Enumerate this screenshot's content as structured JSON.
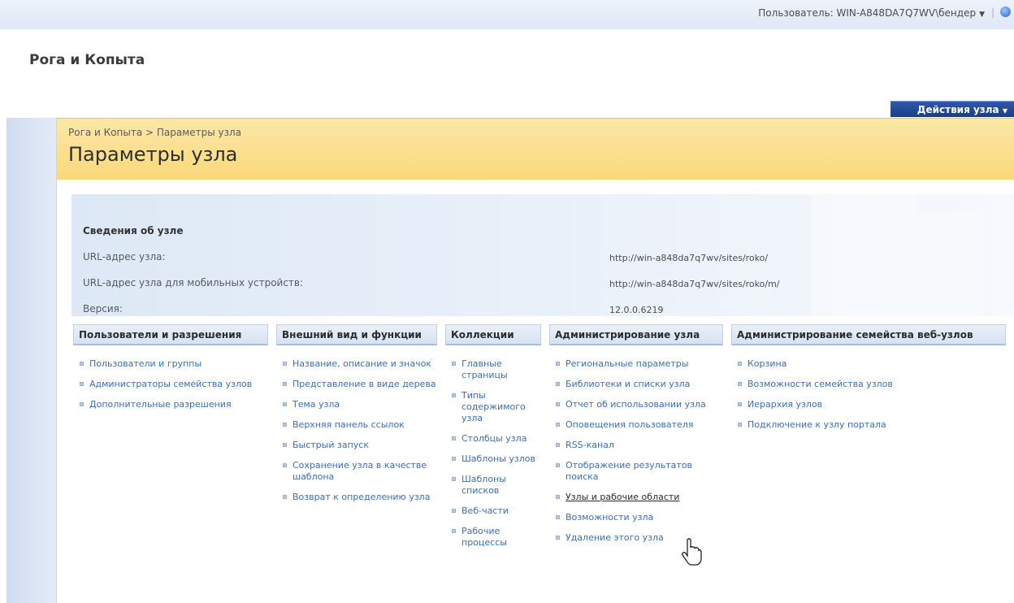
{
  "topbar": {
    "user_label": "Пользователь: WIN-A848DA7Q7WV\\бендер",
    "separator": "|"
  },
  "site": {
    "title": "Рога и Копыта",
    "actions_menu": "Действия узла"
  },
  "breadcrumb": "Рога и Копыта > Параметры узла",
  "page_title": "Параметры узла",
  "site_info": {
    "heading": "Сведения об узле",
    "rows": [
      {
        "label": "URL-адрес узла:",
        "value": "http://win-a848da7q7wv/sites/roko/"
      },
      {
        "label": "URL-адрес узла для мобильных устройств:",
        "value": "http://win-a848da7q7wv/sites/roko/m/"
      },
      {
        "label": "Версия:",
        "value": "12.0.0.6219"
      }
    ]
  },
  "columns": [
    {
      "header": "Пользователи и разрешения",
      "items": [
        "Пользователи и группы",
        "Администраторы семейства узлов",
        "Дополнительные разрешения"
      ]
    },
    {
      "header": "Внешний вид и функции",
      "items": [
        "Название, описание и значок",
        "Представление в виде дерева",
        "Тема узла",
        "Верхняя панель ссылок",
        "Быстрый запуск",
        "Сохранение узла в качестве шаблона",
        "Возврат к определению узла"
      ]
    },
    {
      "header": "Коллекции",
      "items": [
        "Главные страницы",
        "Типы содержимого узла",
        "Столбцы узла",
        "Шаблоны узлов",
        "Шаблоны списков",
        "Веб-части",
        "Рабочие процессы"
      ]
    },
    {
      "header": "Администрирование узла",
      "items": [
        "Региональные параметры",
        "Библиотеки и списки узла",
        "Отчет об использовании узла",
        "Оповещения пользователя",
        "RSS-канал",
        "Отображение результатов поиска",
        "Узлы и рабочие области",
        "Возможности узла",
        "Удаление этого узла"
      ]
    },
    {
      "header": "Администрирование семейства веб-узлов",
      "items": [
        "Корзина",
        "Возможности семейства узлов",
        "Иерархия узлов",
        "Подключение к узлу портала"
      ]
    }
  ],
  "hovered_item": "Узлы и рабочие области",
  "icons": {
    "help": "help-icon",
    "dropdown": "chevron-down-icon",
    "bullet": "bullet-icon",
    "cursor": "hand-cursor-icon"
  },
  "colors": {
    "link": "#3a6fbd",
    "title_band": "#fbd97a",
    "action_button": "#193e86"
  }
}
